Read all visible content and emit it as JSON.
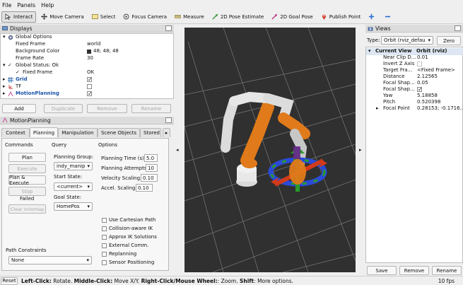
{
  "menu": [
    "File",
    "Panels",
    "Help"
  ],
  "toolbar": {
    "tools": [
      "Interact",
      "Move Camera",
      "Select",
      "Focus Camera",
      "Measure",
      "2D Pose Estimate",
      "2D Goal Pose",
      "Publish Point"
    ],
    "plus_icon": "plus-icon",
    "minus_icon": "minus-icon"
  },
  "displays": {
    "title": "Displays",
    "global_options": "Global Options",
    "fixed_frame_label": "Fixed Frame",
    "fixed_frame_value": "world",
    "background_color_label": "Background Color",
    "background_color_value": "48; 48; 48",
    "background_color_hex": "#303030",
    "frame_rate_label": "Frame Rate",
    "frame_rate_value": "30",
    "global_status": "Global Status: Ok",
    "global_status_fixed_frame": "Fixed Frame",
    "global_status_fixed_frame_value": "OK",
    "grid": "Grid",
    "tf": "TF",
    "motion_planning": "MotionPlanning",
    "buttons": [
      "Add",
      "Duplicate",
      "Remove",
      "Rename"
    ]
  },
  "motion_planning": {
    "title": "MotionPlanning",
    "tabs": [
      "Context",
      "Planning",
      "Manipulation",
      "Scene Objects",
      "Stored"
    ],
    "commands_label": "Commands",
    "query_label": "Query",
    "options_label": "Options",
    "plan_button": "Plan",
    "execute_button": "Execute",
    "plan_execute_button": "Plan & Execute",
    "stop_button": "Stop",
    "status_text": "Failed",
    "clear_octomap_button": "Clear octomap",
    "planning_group_label": "Planning Group:",
    "planning_group_value": "indy_manip",
    "start_state_label": "Start State:",
    "start_state_value": "<current>",
    "goal_state_label": "Goal State:",
    "goal_state_value": "HomePos",
    "planning_time_label": "Planning Time (s):",
    "planning_time_value": "5.0",
    "planning_attempts_label": "Planning Attempts:",
    "planning_attempts_value": "10",
    "velocity_scaling_label": "Velocity Scaling:",
    "velocity_scaling_value": "0.10",
    "accel_scaling_label": "Accel. Scaling:",
    "accel_scaling_value": "0.10",
    "checkboxes": [
      "Use Cartesian Path",
      "Collision-aware IK",
      "Approx IK Solutions",
      "External Comm.",
      "Replanning",
      "Sensor Positioning"
    ],
    "path_constraints_label": "Path Constraints",
    "path_constraints_value": "None"
  },
  "views": {
    "title": "Views",
    "type_label": "Type:",
    "type_value": "Orbit (rviz_defau",
    "zero_button": "Zero",
    "current_view_label": "Current View",
    "current_view_value": "Orbit (rviz)",
    "props": [
      {
        "label": "Near Clip D...",
        "value": "0.01"
      },
      {
        "label": "Invert Z Axis",
        "value": ""
      },
      {
        "label": "Target Fra...",
        "value": "<Fixed Frame>"
      },
      {
        "label": "Distance",
        "value": "2.12565"
      },
      {
        "label": "Focal Shap...",
        "value": "0.05"
      },
      {
        "label": "Focal Shap...",
        "value": ""
      },
      {
        "label": "Yaw",
        "value": "5.18858"
      },
      {
        "label": "Pitch",
        "value": "0.520398"
      },
      {
        "label": "Focal Point",
        "value": "0.28153; -0.1716..."
      }
    ],
    "buttons": [
      "Save",
      "Remove",
      "Rename"
    ]
  },
  "status": {
    "reset": "Reset",
    "hint_left_click": "Left-Click:",
    "hint_rotate": " Rotate. ",
    "hint_middle_click": "Middle-Click:",
    "hint_move": " Move X/Y. ",
    "hint_right_click": "Right-Click/Mouse Wheel:",
    "hint_zoom": ": Zoom. ",
    "hint_shift": "Shift",
    "hint_more": ": More options.",
    "fps": "10 fps"
  }
}
